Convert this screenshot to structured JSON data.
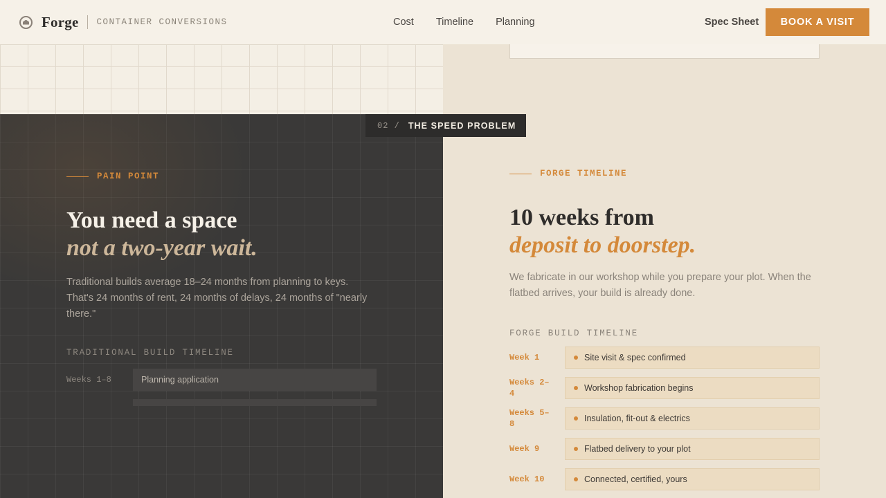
{
  "header": {
    "brand": "Forge",
    "brand_sub": "CONTAINER CONVERSIONS",
    "nav": [
      "Cost",
      "Timeline",
      "Planning"
    ],
    "spec_sheet": "Spec Sheet",
    "cta": "BOOK A VISIT"
  },
  "section_tag": {
    "number": "02 /",
    "title": "THE SPEED PROBLEM"
  },
  "pain": {
    "eyebrow": "PAIN POINT",
    "headline": "You need a space",
    "headline_italic": "not a two-year wait.",
    "body": "Traditional builds average 18–24 months from planning to keys. That's 24 months of rent, 24 months of delays, 24 months of \"nearly there.\"",
    "timeline_label": "TRADITIONAL BUILD TIMELINE",
    "timeline": [
      {
        "week": "Weeks 1–8",
        "label": "Planning application"
      }
    ]
  },
  "forge": {
    "eyebrow": "FORGE TIMELINE",
    "headline": "10 weeks from",
    "headline_italic": "deposit to doorstep.",
    "body": "We fabricate in our workshop while you prepare your plot. When the flatbed arrives, your build is already done.",
    "timeline_label": "FORGE BUILD TIMELINE",
    "timeline": [
      {
        "week": "Week 1",
        "label": "Site visit & spec confirmed"
      },
      {
        "week": "Weeks 2–4",
        "label": "Workshop fabrication begins"
      },
      {
        "week": "Weeks 5–8",
        "label": "Insulation, fit-out & electrics"
      },
      {
        "week": "Week 9",
        "label": "Flatbed delivery to your plot"
      },
      {
        "week": "Week 10",
        "label": "Connected, certified, yours"
      }
    ]
  },
  "colors": {
    "accent": "#d4893a",
    "dark": "#3a3938",
    "cream": "#ece3d4"
  }
}
